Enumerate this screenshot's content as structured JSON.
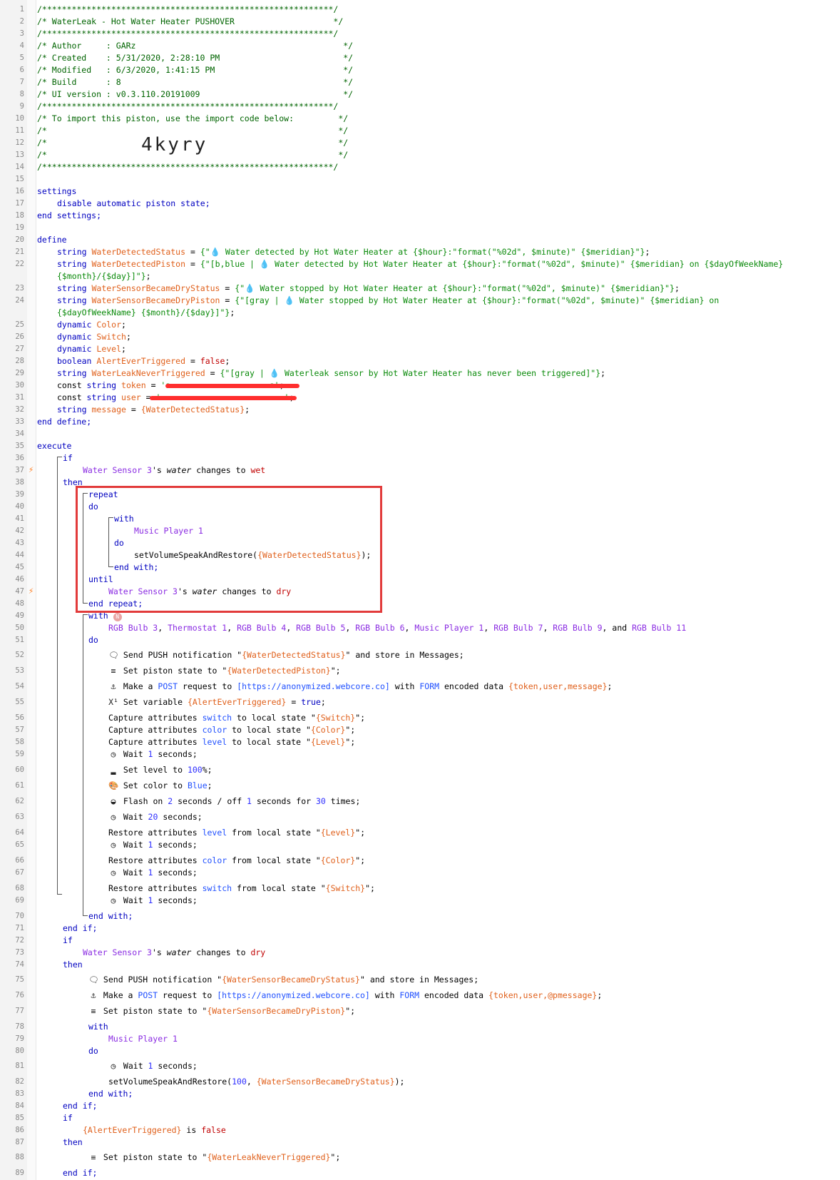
{
  "editor": {
    "lines": [
      {
        "n": 1,
        "t": "/***********************************************************/",
        "c": "cm"
      },
      {
        "n": 2,
        "t": "/* WaterLeak - Hot Water Heater PUSHOVER                    */",
        "c": "cm"
      },
      {
        "n": 3,
        "t": "/***********************************************************/",
        "c": "cm"
      },
      {
        "n": 4,
        "t": "/* Author     : GARz                                          */",
        "c": "cm"
      },
      {
        "n": 5,
        "t": "/* Created    : 5/31/2020, 2:28:10 PM                         */",
        "c": "cm"
      },
      {
        "n": 6,
        "t": "/* Modified   : 6/3/2020, 1:41:15 PM                          */",
        "c": "cm"
      },
      {
        "n": 7,
        "t": "/* Build      : 8                                             */",
        "c": "cm"
      },
      {
        "n": 8,
        "t": "/* UI version : v0.3.110.20191009                             */",
        "c": "cm"
      },
      {
        "n": 9,
        "t": "/***********************************************************/",
        "c": "cm"
      },
      {
        "n": 10,
        "t": "/* To import this piston, use the import code below:         */",
        "c": "cm"
      },
      {
        "n": 11,
        "t": "/*                                                           */",
        "c": "cm"
      },
      {
        "n": 12,
        "t": "/*                                                           */",
        "c": "cm"
      },
      {
        "n": 13,
        "t": "/*                                                           */",
        "c": "cm"
      },
      {
        "n": 14,
        "t": "/***********************************************************/",
        "c": "cm"
      }
    ],
    "import_code": "4kyry",
    "settings": {
      "open": "settings",
      "body": "disable automatic piston state;",
      "close": "end settings;"
    },
    "define": {
      "open": "define",
      "close": "end define;"
    },
    "execute_label": "execute"
  }
}
